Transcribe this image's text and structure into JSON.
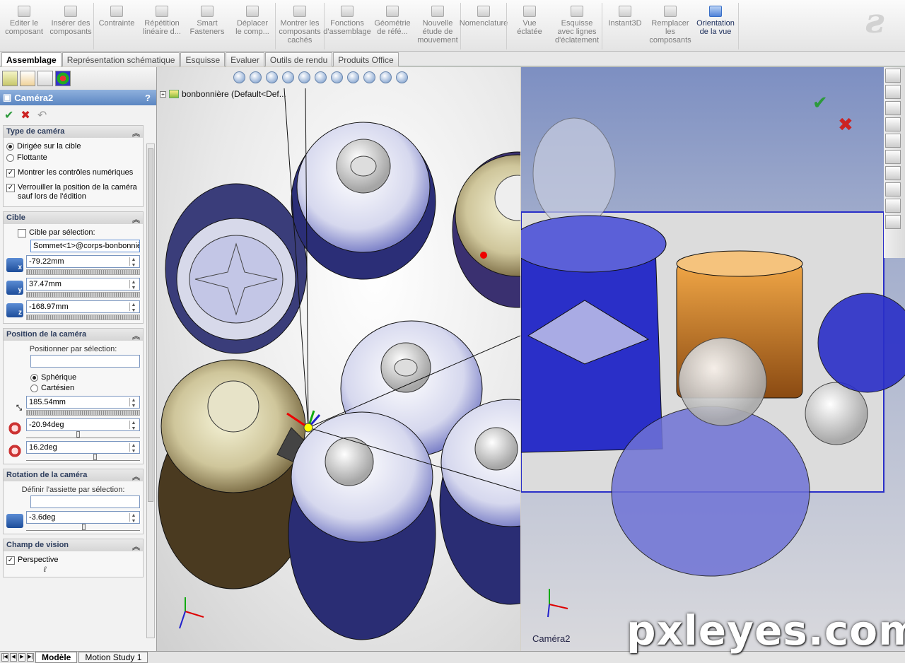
{
  "ribbon": {
    "buttons": [
      {
        "label": "Editer le\ncomposant",
        "icon": "edit-component-icon",
        "active": false
      },
      {
        "label": "Insérer des\ncomposants",
        "icon": "insert-components-icon",
        "active": false
      },
      {
        "label": "Contrainte",
        "icon": "mate-icon",
        "active": false
      },
      {
        "label": "Répétition\nlinéaire d...",
        "icon": "linear-pattern-icon",
        "active": false
      },
      {
        "label": "Smart\nFasteners",
        "icon": "smart-fasteners-icon",
        "active": false
      },
      {
        "label": "Déplacer\nle comp...",
        "icon": "move-component-icon",
        "active": false
      },
      {
        "label": "Montrer les\ncomposants\ncachés",
        "icon": "show-hidden-icon",
        "active": false
      },
      {
        "label": "Fonctions\nd'assemblage",
        "icon": "assembly-features-icon",
        "active": false
      },
      {
        "label": "Géométrie\nde réfé...",
        "icon": "reference-geometry-icon",
        "active": false
      },
      {
        "label": "Nouvelle\nétude de\nmouvement",
        "icon": "motion-study-icon",
        "active": false
      },
      {
        "label": "Nomenclature",
        "icon": "bom-icon",
        "active": false
      },
      {
        "label": "Vue\néclatée",
        "icon": "exploded-view-icon",
        "active": false
      },
      {
        "label": "Esquisse\navec lignes\nd'éclatement",
        "icon": "explode-line-sketch-icon",
        "active": false
      },
      {
        "label": "Instant3D",
        "icon": "instant3d-icon",
        "active": false
      },
      {
        "label": "Remplacer\nles\ncomposants",
        "icon": "replace-components-icon",
        "active": false
      },
      {
        "label": "Orientation\nde la vue",
        "icon": "view-orientation-icon",
        "active": true
      }
    ]
  },
  "tabs": [
    "Assemblage",
    "Représentation schématique",
    "Esquisse",
    "Evaluer",
    "Outils de rendu",
    "Produits Office"
  ],
  "active_tab": "Assemblage",
  "property_manager": {
    "title": "Caméra2",
    "help": "?",
    "ok_glyph": "✔",
    "cancel_glyph": "✖",
    "undo_glyph": "↶",
    "camera_type": {
      "heading": "Type de caméra",
      "opt_target": "Dirigée sur la cible",
      "opt_float": "Flottante",
      "show_numeric": "Montrer les contrôles numériques",
      "lock_position": "Verrouiller la position de la caméra sauf lors de l'édition"
    },
    "target": {
      "heading": "Cible",
      "by_selection": "Cible par sélection:",
      "selection_value": "Sommet<1>@corps-bonbonnièr",
      "x": "-79.22mm",
      "y": "37.47mm",
      "z": "-168.97mm",
      "x_axis": "x",
      "y_axis": "y",
      "z_axis": "z"
    },
    "position": {
      "heading": "Position de la caméra",
      "by_selection": "Positionner par sélection:",
      "opt_spherical": "Sphérique",
      "opt_cartesian": "Cartésien",
      "distance": "185.54mm",
      "angle1": "-20.94deg",
      "angle2": "16.2deg"
    },
    "rotation": {
      "heading": "Rotation de la caméra",
      "by_selection": "Définir l'assiette par sélection:",
      "roll": "-3.6deg"
    },
    "fov": {
      "heading": "Champ de vision",
      "perspective": "Perspective",
      "symbol": "ℓ"
    }
  },
  "viewport_left": {
    "tree_label": "bonbonnière  (Default<Def..."
  },
  "viewport_right": {
    "camera_label": "Caméra2",
    "ok_glyph": "✔",
    "cancel_glyph": "✖"
  },
  "bottom": {
    "tabs": [
      "Modèle",
      "Motion Study 1"
    ]
  },
  "watermark": "pxleyes.com",
  "colors": {
    "accent_blue": "#3a6fc7",
    "glass_blue": "#2a2fc8",
    "amber": "#d88b2a",
    "ok_green": "#2c9a3b",
    "cancel_red": "#c22222"
  }
}
